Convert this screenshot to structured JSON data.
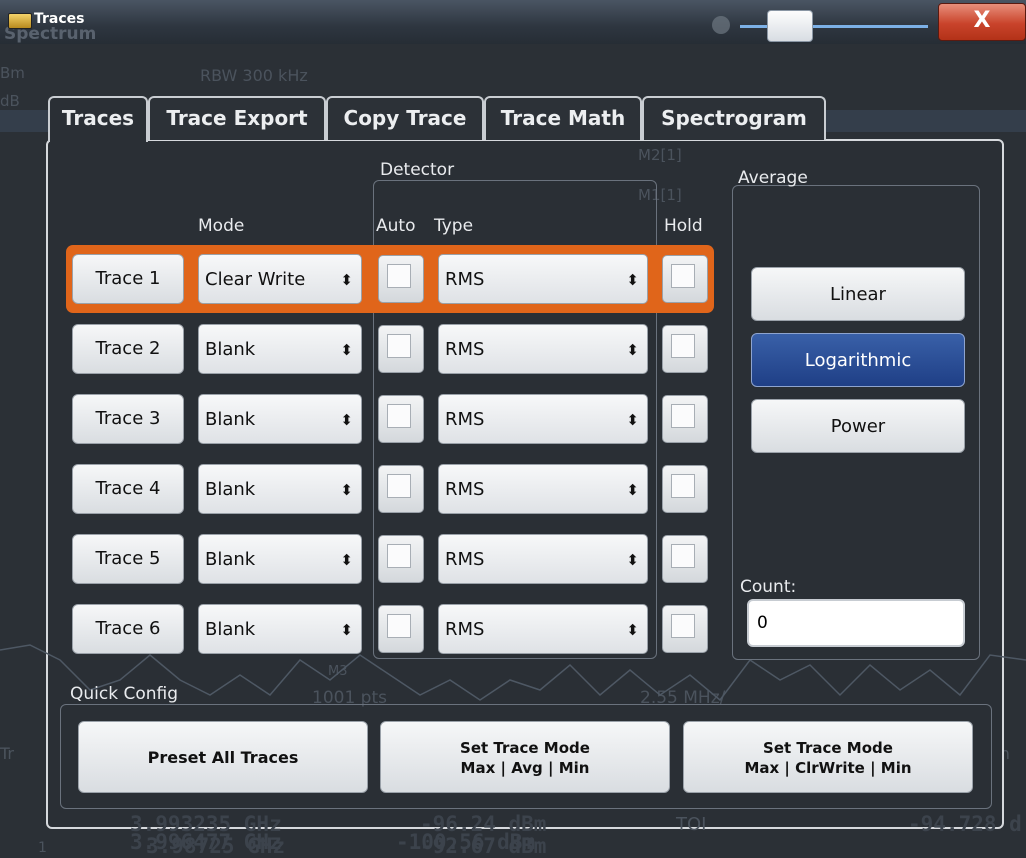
{
  "window": {
    "title": "Traces",
    "background_title": "Spectrum",
    "close_glyph": "X"
  },
  "background": {
    "rbw": "RBW 300 kHz",
    "unit_fragment_1": "Bm",
    "unit_fragment_2": "dB",
    "marker_m2": "M2[1]",
    "marker_m1": "M1[1]",
    "marker_m3": "M3",
    "points": "1001 pts",
    "span_per_div": "2.55 MHz/",
    "table_fragment_left": "Tr",
    "table_fragment_right": "on R",
    "row1_freq": "3.993235 GHz",
    "row1_level": "-96.24 dBm",
    "row1_func": "TOI",
    "row1_result": "-94.728 d",
    "row2_freq": "3.996477 GHz",
    "row2_level": "-100.56 dBm",
    "row3_freq": "3.98725 GHz",
    "row3_level": "-92.67 dBm",
    "row3_index": "1"
  },
  "tabs": [
    {
      "label": "Traces",
      "active": true
    },
    {
      "label": "Trace Export"
    },
    {
      "label": "Copy Trace"
    },
    {
      "label": "Trace Math"
    },
    {
      "label": "Spectrogram"
    }
  ],
  "headers": {
    "mode": "Mode",
    "detector": "Detector",
    "auto": "Auto",
    "type": "Type",
    "hold": "Hold",
    "average": "Average",
    "count": "Count:",
    "quick_config": "Quick Config"
  },
  "traces": [
    {
      "label": "Trace 1",
      "mode": "Clear Write",
      "detector": "RMS",
      "auto": false,
      "hold": false,
      "selected": true
    },
    {
      "label": "Trace 2",
      "mode": "Blank",
      "detector": "RMS",
      "auto": false,
      "hold": false
    },
    {
      "label": "Trace 3",
      "mode": "Blank",
      "detector": "RMS",
      "auto": false,
      "hold": false
    },
    {
      "label": "Trace 4",
      "mode": "Blank",
      "detector": "RMS",
      "auto": false,
      "hold": false
    },
    {
      "label": "Trace 5",
      "mode": "Blank",
      "detector": "RMS",
      "auto": false,
      "hold": false
    },
    {
      "label": "Trace 6",
      "mode": "Blank",
      "detector": "RMS",
      "auto": false,
      "hold": false
    }
  ],
  "average": {
    "options": [
      {
        "label": "Linear",
        "active": false
      },
      {
        "label": "Logarithmic",
        "active": true
      },
      {
        "label": "Power",
        "active": false
      }
    ],
    "count_value": "0"
  },
  "quick_config": {
    "preset": "Preset All Traces",
    "mode1_line1": "Set Trace Mode",
    "mode1_line2": "Max | Avg | Min",
    "mode2_line1": "Set Trace Mode",
    "mode2_line2": "Max | ClrWrite | Min"
  },
  "colors": {
    "selection": "#e0651a",
    "active_button": "#2a4f98"
  },
  "icons": {
    "dropdown": "updown-arrow-icon",
    "window": "spectrum-app-icon"
  }
}
